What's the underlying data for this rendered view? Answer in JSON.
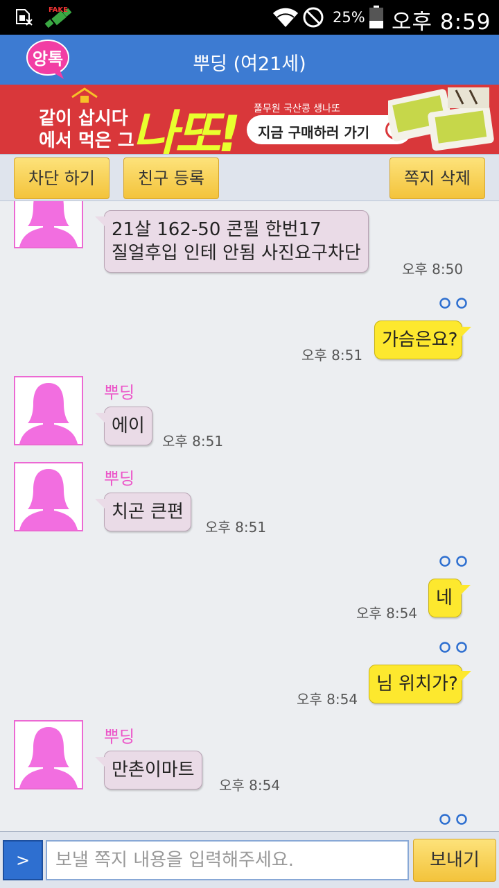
{
  "status_bar": {
    "fake_label": "FAKE",
    "battery_percent": "25%",
    "time": "오후 8:59"
  },
  "header": {
    "logo_text": "앙톡",
    "title": "뿌딩 (여21세)"
  },
  "ad": {
    "line1": "같이 삽시다",
    "line2": "에서 먹은 그",
    "big_text": "나또!",
    "small_text": "풀무원 국산콩 생나또",
    "cta": "지금 구매하러 가기"
  },
  "toolbar": {
    "block_label": "차단 하기",
    "friend_label": "친구 등록",
    "delete_label": "쪽지 삭제"
  },
  "messages": [
    {
      "from": "in",
      "sender": "",
      "lines": [
        "21살 162-50 콘필 한번17",
        "질얼후입 인테 안됨 사진요구차단"
      ],
      "time": "오후 8:50"
    },
    {
      "from": "out",
      "text": "가슴은요?",
      "time": "오후 8:51",
      "read_mark": "oo"
    },
    {
      "from": "in",
      "sender": "뿌딩",
      "text": "에이",
      "time": "오후 8:51"
    },
    {
      "from": "in",
      "sender": "뿌딩",
      "text": "치곤 큰편",
      "time": "오후 8:51"
    },
    {
      "from": "out",
      "text": "네",
      "time": "오후 8:54",
      "read_mark": "oo"
    },
    {
      "from": "out",
      "text": "님 위치가?",
      "time": "오후 8:54",
      "read_mark": "oo"
    },
    {
      "from": "in",
      "sender": "뿌딩",
      "text": "만촌이마트",
      "time": "오후 8:54"
    },
    {
      "from": "out",
      "text": "",
      "time": "",
      "read_mark": "oo"
    }
  ],
  "composer": {
    "toggle_label": ">",
    "placeholder": "보낼 쪽지 내용을 입력해주세요.",
    "send_label": "보내기"
  },
  "colors": {
    "title_bar": "#3d7bd2",
    "ad_background": "#d9373a",
    "incoming_bubble": "#eadbe7",
    "outgoing_bubble": "#fde82e",
    "sender_name": "#ec57c9",
    "read_mark": "#2e6fd0",
    "avatar": "#f26ee0"
  }
}
